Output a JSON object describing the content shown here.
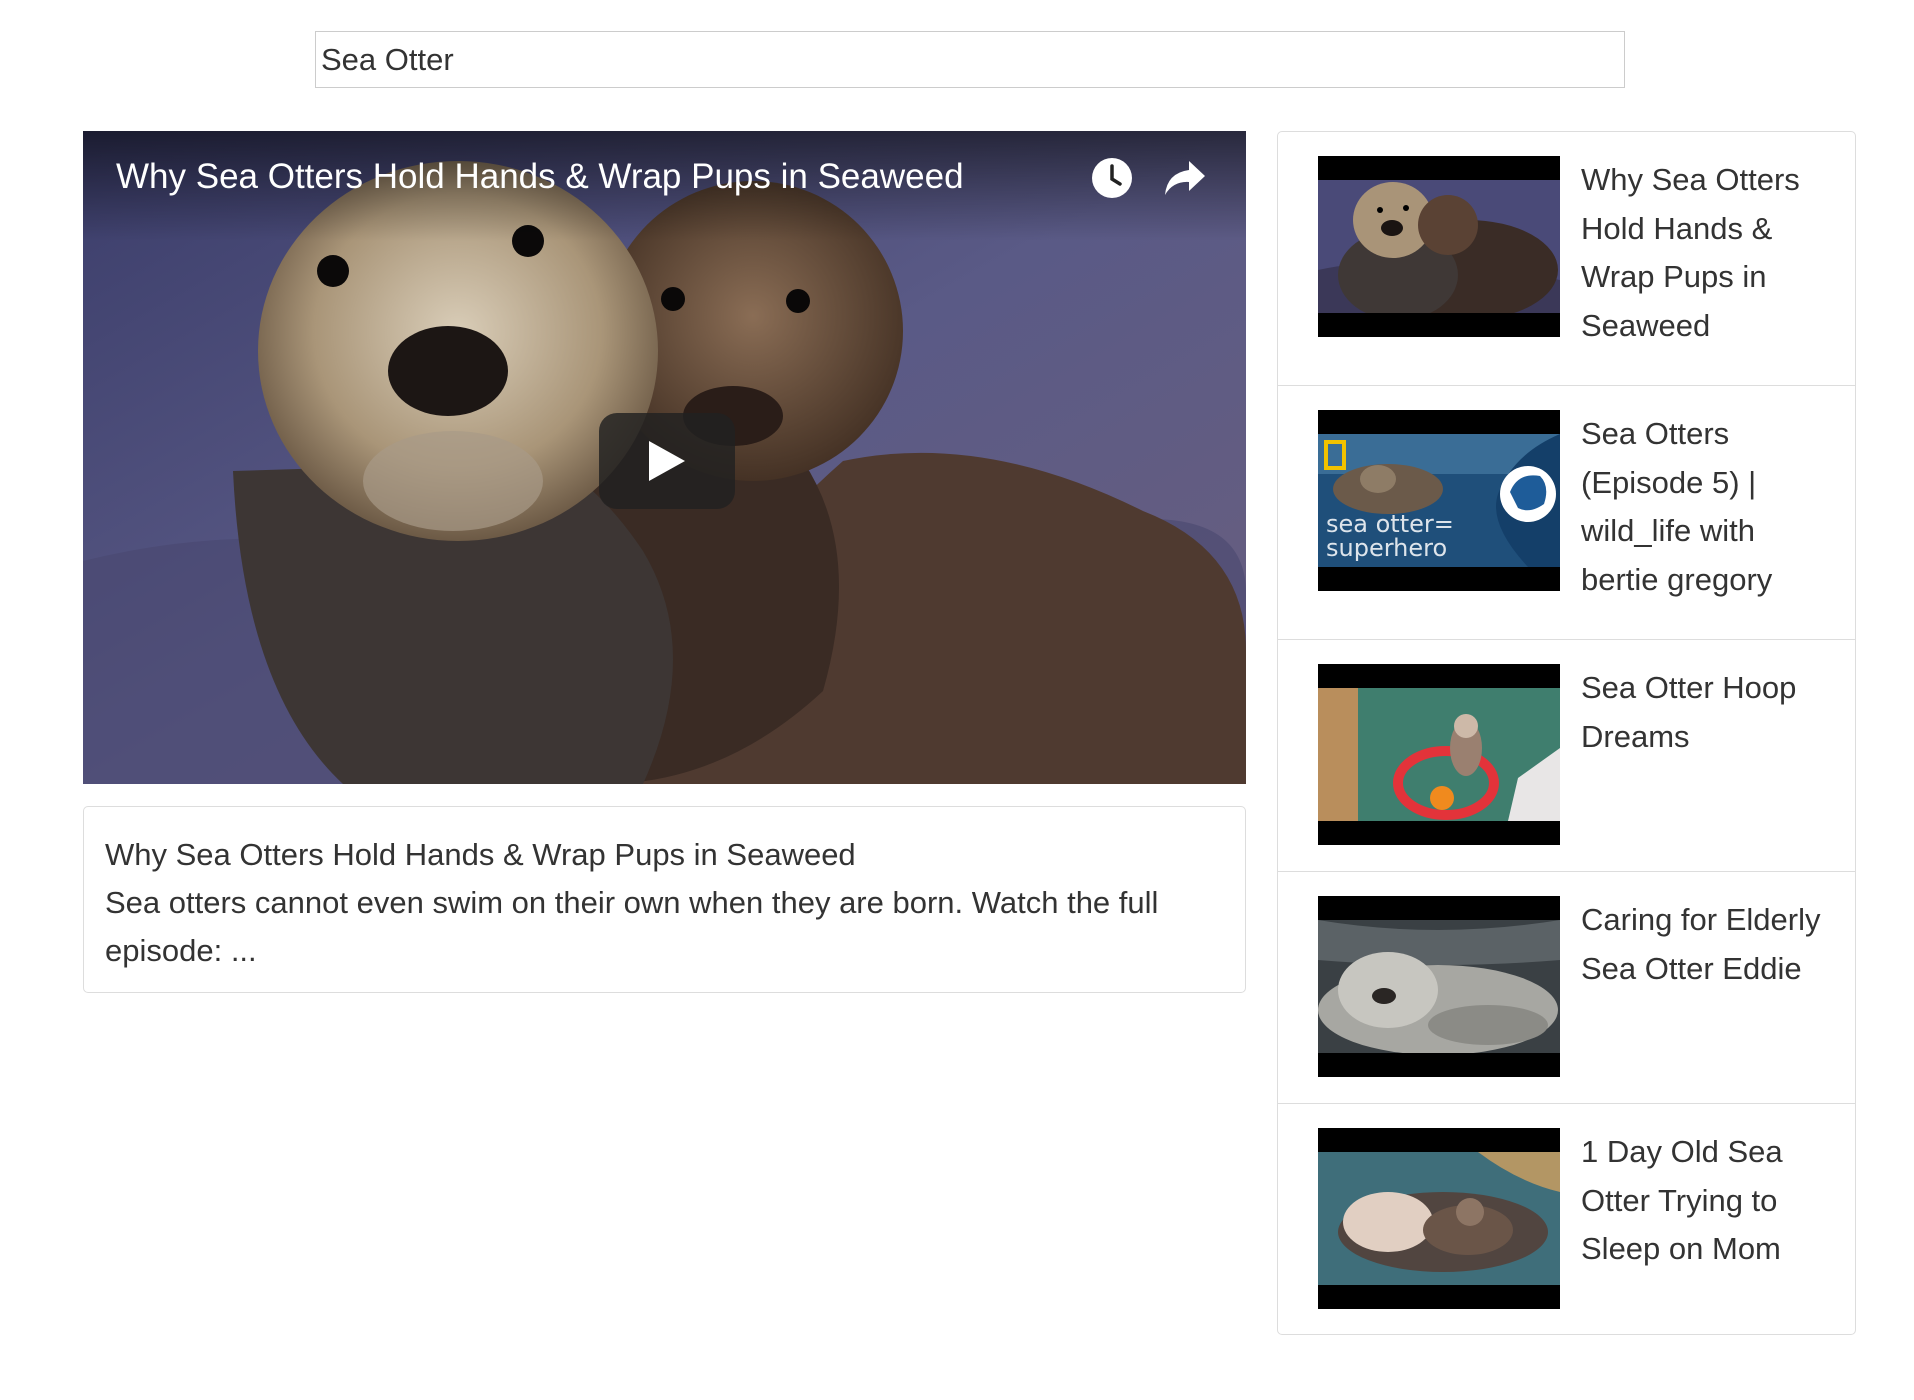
{
  "search": {
    "value": "Sea Otter",
    "placeholder": ""
  },
  "player": {
    "title": "Why Sea Otters Hold Hands & Wrap Pups in Seaweed",
    "icons": {
      "watch_later": "clock-icon",
      "share": "share-icon",
      "play": "play-icon"
    }
  },
  "description": {
    "title": "Why Sea Otters Hold Hands & Wrap Pups in Seaweed",
    "text": "Sea otters cannot even swim on their own when they are born. Watch the full episode: ..."
  },
  "videos": [
    {
      "title": "Why Sea Otters Hold Hands & Wrap Pups in Seaweed",
      "overlay": ""
    },
    {
      "title": "Sea Otters (Episode 5) | wild_life with bertie gregory",
      "overlay": "sea otter = superhero"
    },
    {
      "title": "Sea Otter Hoop Dreams",
      "overlay": ""
    },
    {
      "title": "Caring for Elderly Sea Otter Eddie",
      "overlay": ""
    },
    {
      "title": "1 Day Old Sea Otter Trying to Sleep on Mom",
      "overlay": ""
    }
  ],
  "colors": {
    "border": "#dddddd",
    "text": "#333333",
    "player_overlay_text": "#ffffff",
    "play_button_bg": "#212121"
  }
}
